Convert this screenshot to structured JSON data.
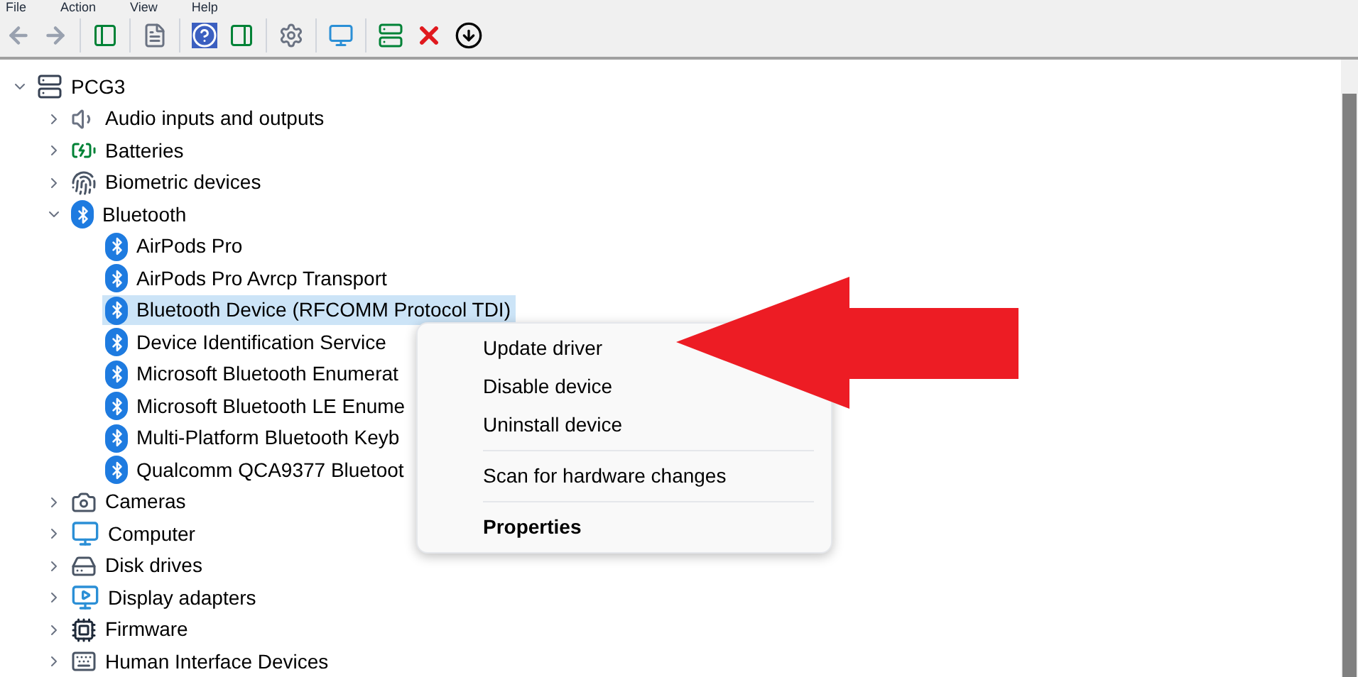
{
  "menu_bar": [
    "File",
    "Action",
    "View",
    "Help"
  ],
  "toolbar": [
    {
      "kind": "back",
      "disabled": true
    },
    {
      "kind": "forward",
      "disabled": true
    },
    {
      "kind": "sep"
    },
    {
      "kind": "tree"
    },
    {
      "kind": "sep"
    },
    {
      "kind": "properties"
    },
    {
      "kind": "sep"
    },
    {
      "kind": "help"
    },
    {
      "kind": "pane"
    },
    {
      "kind": "sep"
    },
    {
      "kind": "update"
    },
    {
      "kind": "sep"
    },
    {
      "kind": "scan"
    },
    {
      "kind": "sep"
    },
    {
      "kind": "enable"
    },
    {
      "kind": "uninstall"
    },
    {
      "kind": "disable"
    }
  ],
  "tree": {
    "label": "PCG3",
    "kind": "computer",
    "expanded": true,
    "children": [
      {
        "label": "Audio inputs and outputs",
        "kind": "audio",
        "expanded": false
      },
      {
        "label": "Batteries",
        "kind": "battery",
        "expanded": false
      },
      {
        "label": "Biometric devices",
        "kind": "biometric",
        "expanded": false
      },
      {
        "label": "Bluetooth",
        "kind": "bluetooth",
        "expanded": true,
        "children": [
          {
            "label": "AirPods Pro",
            "kind": "bluetooth",
            "selected": false
          },
          {
            "label": "AirPods Pro Avrcp Transport",
            "kind": "bluetooth",
            "selected": false
          },
          {
            "label": "Bluetooth Device (RFCOMM Protocol TDI)",
            "kind": "bluetooth",
            "selected": true
          },
          {
            "label": "Device Identification Service",
            "kind": "bluetooth",
            "selected": false
          },
          {
            "label": "Microsoft Bluetooth Enumerat",
            "kind": "bluetooth",
            "selected": false
          },
          {
            "label": "Microsoft Bluetooth LE Enume",
            "kind": "bluetooth",
            "selected": false
          },
          {
            "label": "Multi-Platform Bluetooth Keyb",
            "kind": "bluetooth",
            "selected": false
          },
          {
            "label": "Qualcomm QCA9377 Bluetoot",
            "kind": "bluetooth",
            "selected": false
          }
        ]
      },
      {
        "label": "Cameras",
        "kind": "camera",
        "expanded": false
      },
      {
        "label": "Computer",
        "kind": "monitor",
        "expanded": false
      },
      {
        "label": "Disk drives",
        "kind": "disk",
        "expanded": false
      },
      {
        "label": "Display adapters",
        "kind": "display",
        "expanded": false
      },
      {
        "label": "Firmware",
        "kind": "firmware",
        "expanded": false
      },
      {
        "label": "Human Interface Devices",
        "kind": "hid",
        "expanded": false
      }
    ]
  },
  "context_menu": [
    {
      "kind": "item",
      "label": "Update driver"
    },
    {
      "kind": "item",
      "label": "Disable device"
    },
    {
      "kind": "item",
      "label": "Uninstall device"
    },
    {
      "kind": "separator"
    },
    {
      "kind": "item",
      "label": "Scan for hardware changes"
    },
    {
      "kind": "separator"
    },
    {
      "kind": "default",
      "label": "Properties"
    }
  ]
}
